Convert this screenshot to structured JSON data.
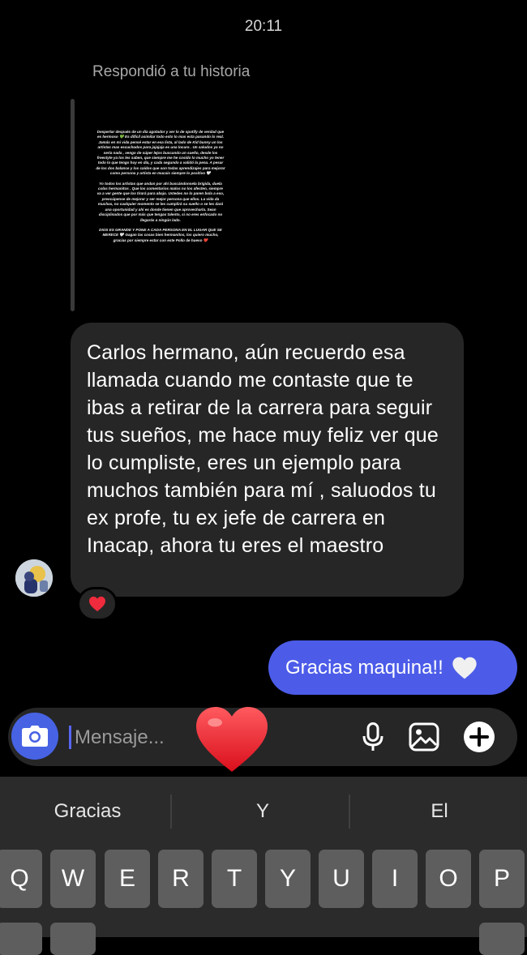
{
  "status": {
    "time": "20:11"
  },
  "chat": {
    "reply_note": "Respondió a tu historia",
    "story_paragraphs": [
      "Despertar después de un día agotador y ver lo de spotify de verdad que es hermoso 💚 Es difícil asimilar todo esto lo mas esta pasando lo real. Jamás en mi vida pensé estar en esa lista, al lado de Kid bunny un los artistas mas escuchados para jajajaja es una locura . Un saludos ya no sería nada , vengo de súper lejos buscando un sueño, desde los freestyle ya los les saben, que siempre me he cosido lo mucho yo tener todo lo que tengo hoy en día, y cada segundo a validó la pena. A pesar de los dos balance y los caídos que son todas aprendizajes para mejorar como persona y artista en mucais siempre lo positivo 🤍",
      "Yo todos los artistas que andan por ahí buscándonsela brígida, duela colas hermanitos . Que los comentarios malos no los afecten, siempre va a ver gente que los tirará para abajo. Ustedes no lo paren bola a eso, preocúpense de mejorar y ser mejor persona que ellos. La vida da muchas, no cualquier momento se les cumplirá su sueño o se les dará una oportunidad y ahí es donde tienen que aprovecharla. Sean disciplinados que por más que tengas talento, si no eres enfocado no llegarás a ningún lado.",
      "DIOS ES GRANDE Y PONE A CADA PERSONA EN EL LUGAR QUE SE MERECE 🤍 Gagan las cosas bien hermanitos, los quiero mucho, gracias por siempre estar con este Pollo de huevo ❤️"
    ],
    "incoming_message": "Carlos hermano, aún recuerdo esa llamada cuando me contaste que te ibas a retirar de la carrera para seguir tus sueños, me hace muy feliz ver que lo cumpliste, eres un ejemplo para muchos también para mí , saluodos tu ex profe, tu ex jefe de carrera en Inacap, ahora tu eres el maestro",
    "reaction": "❤️",
    "outgoing_message": "Gracias maquina!!",
    "outgoing_emoji": "🤍"
  },
  "composer": {
    "placeholder": "Mensaje...",
    "icons": [
      "camera-icon",
      "microphone-icon",
      "image-icon",
      "plus-icon"
    ],
    "floating_heart": "red-heart"
  },
  "keyboard": {
    "suggestions": [
      "Gracias",
      "Y",
      "El"
    ],
    "row1": [
      "Q",
      "W",
      "E",
      "R",
      "T",
      "Y",
      "U",
      "I",
      "O",
      "P"
    ]
  },
  "colors": {
    "background": "#000000",
    "incoming_bubble": "#262626",
    "outgoing_bubble": "#4c5ce8",
    "camera_button": "#4763e4",
    "keyboard_bg": "#2b2b2b",
    "key_bg": "#5e5e5e"
  }
}
